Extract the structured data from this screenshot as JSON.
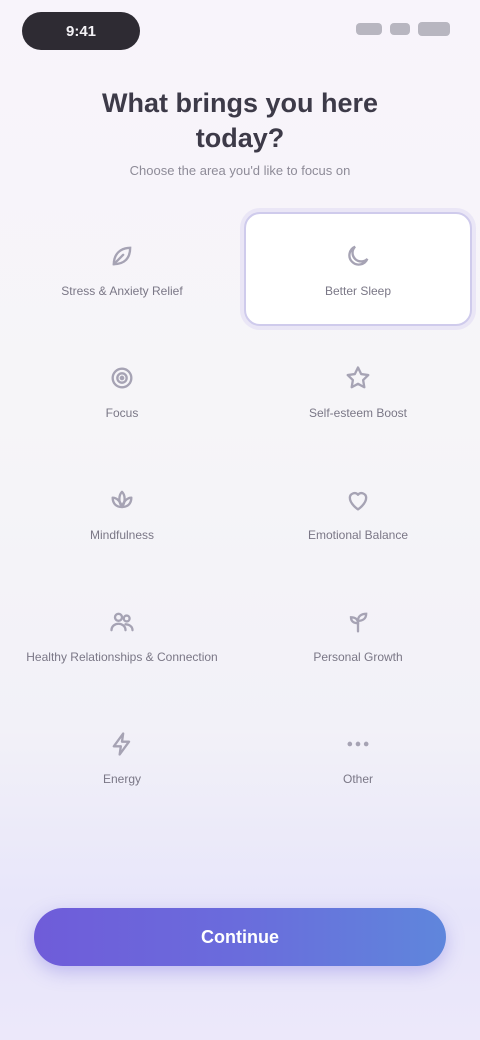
{
  "status_bar": {
    "time": "9:41"
  },
  "header": {
    "title": "What brings you here today?",
    "subtitle": "Choose the area you'd like to focus on"
  },
  "options": [
    {
      "label": "Stress & Anxiety Relief",
      "icon": "leaf-icon",
      "selected": false
    },
    {
      "label": "Better Sleep",
      "icon": "moon-icon",
      "selected": true
    },
    {
      "label": "Focus",
      "icon": "target-icon",
      "selected": false
    },
    {
      "label": "Self-esteem Boost",
      "icon": "star-icon",
      "selected": false
    },
    {
      "label": "Mindfulness",
      "icon": "lotus-icon",
      "selected": false
    },
    {
      "label": "Emotional Balance",
      "icon": "heart-icon",
      "selected": false
    },
    {
      "label": "Healthy Relationships & Connection",
      "icon": "people-icon",
      "selected": false
    },
    {
      "label": "Personal Growth",
      "icon": "sprout-icon",
      "selected": false
    },
    {
      "label": "Energy",
      "icon": "bolt-icon",
      "selected": false
    },
    {
      "label": "Other",
      "icon": "dots-icon",
      "selected": false
    }
  ],
  "cta": {
    "label": "Continue"
  },
  "colors": {
    "accent_start": "#6f5cd9",
    "accent_end": "#5f86dc",
    "icon": "#a6a3b4"
  }
}
